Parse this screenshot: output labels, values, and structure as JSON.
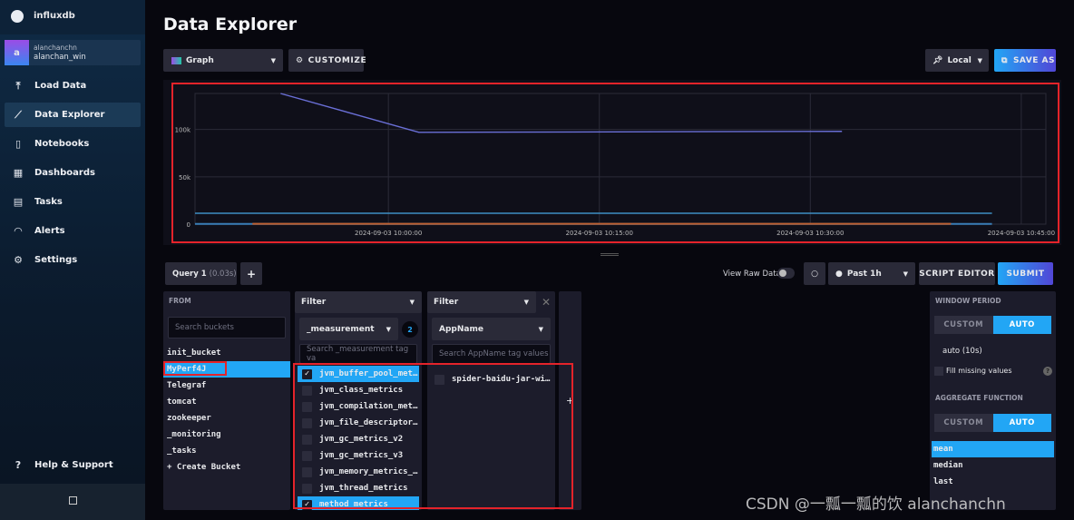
{
  "app": {
    "brand": "influxdb",
    "page_title": "Data Explorer"
  },
  "user": {
    "avatar_letter": "a",
    "org": "alanchanchn",
    "name": "alanchan_win"
  },
  "sidebar": {
    "items": [
      {
        "label": "Load Data",
        "icon": "upload-icon",
        "active": false
      },
      {
        "label": "Data Explorer",
        "icon": "graph-icon",
        "active": true
      },
      {
        "label": "Notebooks",
        "icon": "notebook-icon",
        "active": false
      },
      {
        "label": "Dashboards",
        "icon": "dashboard-icon",
        "active": false
      },
      {
        "label": "Tasks",
        "icon": "calendar-icon",
        "active": false
      },
      {
        "label": "Alerts",
        "icon": "bell-icon",
        "active": false
      },
      {
        "label": "Settings",
        "icon": "gear-icon",
        "active": false
      }
    ],
    "help": "Help & Support"
  },
  "toolbar": {
    "graph_type": "Graph",
    "customize": "CUSTOMIZE",
    "timezone": "Local",
    "save_as": "SAVE AS"
  },
  "chart_data": {
    "type": "line",
    "y_ticks": [
      "0",
      "50k",
      "100k"
    ],
    "x_ticks": [
      "2024-09-03 10:00:00",
      "2024-09-03 10:15:00",
      "2024-09-03 10:30:00",
      "2024-09-03 10:45:00"
    ],
    "xlim": [
      "2024-09-03 09:46:15",
      "2024-09-03 10:46:45"
    ],
    "ylim": [
      0,
      138000
    ],
    "grid": true,
    "series": [
      {
        "color": "#6a6fd6",
        "points": [
          [
            "2024-09-03 09:52:20",
            138000
          ],
          [
            "2024-09-03 10:02:10",
            97000
          ],
          [
            "2024-09-03 10:32:15",
            98000
          ]
        ]
      },
      {
        "color": "#3f8fc4",
        "points": [
          [
            "2024-09-03 09:46:15",
            11500
          ],
          [
            "2024-09-03 10:42:55",
            11500
          ]
        ]
      },
      {
        "color": "#3a7fb8",
        "points": [
          [
            "2024-09-03 09:46:15",
            200
          ],
          [
            "2024-09-03 10:42:55",
            200
          ]
        ]
      },
      {
        "color": "#c06030",
        "points": [
          [
            "2024-09-03 09:50:20",
            300
          ],
          [
            "2024-09-03 10:40:00",
            300
          ]
        ]
      }
    ]
  },
  "query": {
    "tab": "Query 1",
    "time": "(0.03s)",
    "add": "+",
    "view_raw": "View Raw Data",
    "range": "Past 1h",
    "script_editor": "SCRIPT EDITOR",
    "submit": "SUBMIT"
  },
  "from": {
    "header": "FROM",
    "placeholder": "Search buckets",
    "buckets": [
      "init_bucket",
      "MyPerf4J",
      "Telegraf",
      "tomcat",
      "zookeeper",
      "_monitoring",
      "_tasks",
      "+ Create Bucket"
    ],
    "selected": "MyPerf4J"
  },
  "filter1": {
    "header": "Filter",
    "key": "_measurement",
    "count": "2",
    "placeholder": "Search _measurement tag va",
    "values": [
      {
        "label": "jvm_buffer_pool_metri…",
        "checked": true
      },
      {
        "label": "jvm_class_metrics",
        "checked": false
      },
      {
        "label": "jvm_compilation_metri…",
        "checked": false
      },
      {
        "label": "jvm_file_descriptor_m…",
        "checked": false
      },
      {
        "label": "jvm_gc_metrics_v2",
        "checked": false
      },
      {
        "label": "jvm_gc_metrics_v3",
        "checked": false
      },
      {
        "label": "jvm_memory_metrics_v2",
        "checked": false
      },
      {
        "label": "jvm_thread_metrics",
        "checked": false
      },
      {
        "label": "method_metrics",
        "checked": true
      }
    ]
  },
  "filter2": {
    "header": "Filter",
    "key": "AppName",
    "placeholder": "Search AppName tag values",
    "values": [
      {
        "label": "spider-baidu-jar-with…",
        "checked": false
      }
    ]
  },
  "aggregate": {
    "window_label": "WINDOW PERIOD",
    "custom": "CUSTOM",
    "auto": "AUTO",
    "window_value": "auto (10s)",
    "fill_missing": "Fill missing values",
    "agg_label": "AGGREGATE FUNCTION",
    "functions": [
      "mean",
      "median",
      "last"
    ],
    "selected": "mean"
  },
  "colors": {
    "accent": "#22a6f5",
    "highlight": "#e4232a"
  },
  "watermark": "CSDN @一瓢一瓢的饮 alanchanchn"
}
